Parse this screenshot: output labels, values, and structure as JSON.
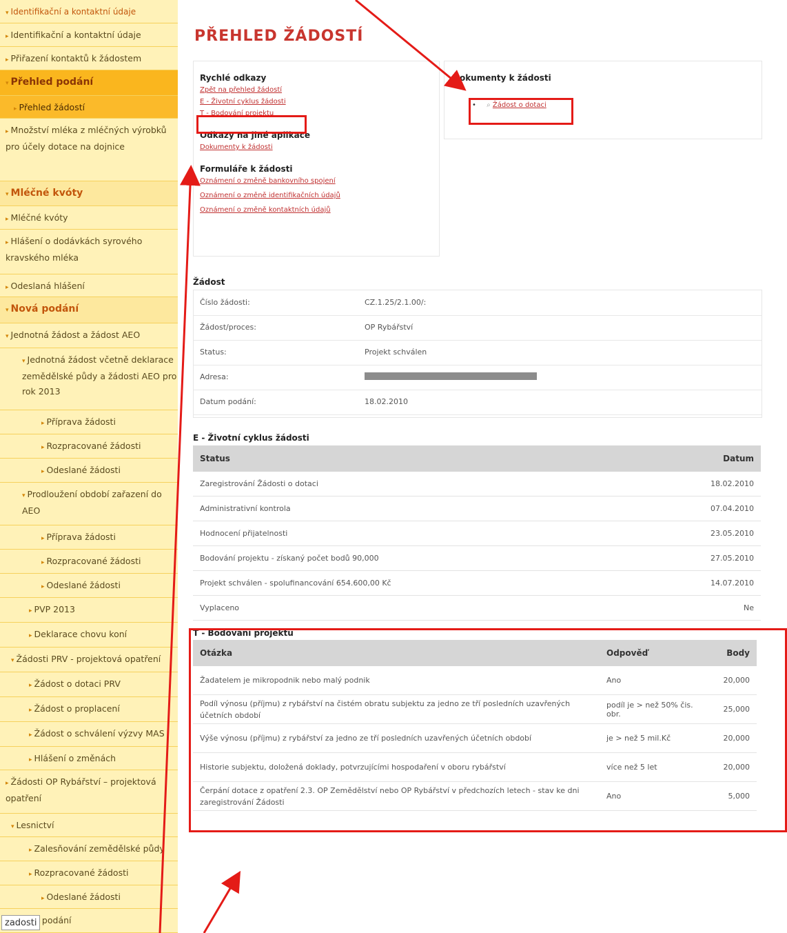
{
  "sidebar": {
    "items": [
      {
        "label": "Identifikační a kontaktní údaje",
        "type": "top"
      },
      {
        "label": "Identifikační a kontaktní údaje",
        "type": "item"
      },
      {
        "label": "Přiřazení kontaktů k žádostem",
        "type": "item"
      },
      {
        "label": "Přehled podání",
        "type": "header_active"
      },
      {
        "label": "Přehled žádostí",
        "type": "active"
      },
      {
        "label": "Množství mléka z mléčných výrobků pro účely dotace na dojnice",
        "type": "item"
      },
      {
        "label": "Mléčné kvóty",
        "type": "header"
      },
      {
        "label": "Mléčné kvóty",
        "type": "item"
      },
      {
        "label": "Hlášení o dodávkách syrového kravského mléka",
        "type": "item"
      },
      {
        "label": "Odeslaná hlášení",
        "type": "item"
      },
      {
        "label": "Nová podání",
        "type": "header"
      },
      {
        "label": "Jednotná žádost a žádost AEO",
        "type": "item"
      },
      {
        "label": "Jednotná žádost včetně deklarace zemědělské půdy a žádosti AEO pro rok 2013",
        "type": "item"
      },
      {
        "label": "Příprava žádosti",
        "type": "item"
      },
      {
        "label": "Rozpracované žádosti",
        "type": "item"
      },
      {
        "label": "Odeslané žádosti",
        "type": "item"
      },
      {
        "label": "Prodloužení období zařazení do AEO",
        "type": "item"
      },
      {
        "label": "Příprava žádosti",
        "type": "item"
      },
      {
        "label": "Rozpracované žádosti",
        "type": "item"
      },
      {
        "label": "Odeslané žádosti",
        "type": "item"
      },
      {
        "label": "PVP 2013",
        "type": "item"
      },
      {
        "label": "Deklarace chovu koní",
        "type": "item"
      },
      {
        "label": "Žádosti PRV - projektová opatření",
        "type": "item"
      },
      {
        "label": "Žádost o dotaci PRV",
        "type": "item"
      },
      {
        "label": "Žádost o proplacení",
        "type": "item"
      },
      {
        "label": "Žádost o schválení výzvy MAS",
        "type": "item"
      },
      {
        "label": "Hlášení o změnách",
        "type": "item"
      },
      {
        "label": "Žádosti OP Rybářství – projektová opatření",
        "type": "item"
      },
      {
        "label": "Lesnictví",
        "type": "item"
      },
      {
        "label": "Zalesňování zemědělské půdy",
        "type": "item"
      },
      {
        "label": "Rozpracované žádosti",
        "type": "item"
      },
      {
        "label": "Odeslané žádosti",
        "type": "item"
      },
      {
        "label": "...ková podání",
        "type": "item"
      }
    ],
    "tooltip": "zadosti"
  },
  "page_title": "PŘEHLED ŽÁDOSTÍ",
  "quick_links": {
    "title": "Rychlé odkazy",
    "links": [
      "Zpět na přehled žádostí",
      "E - Životní cyklus žádosti",
      "T - Bodování projektu"
    ],
    "other_title": "Odkazy na jiné aplikace",
    "other_links": [
      "Dokumenty k žádosti"
    ],
    "forms_title": "Formuláře k žádosti",
    "forms_links": [
      "Oznámení o změně bankovního spojení",
      "Oznámení o změně identifikačních údajů",
      "Oznámení o změně kontaktních údajů"
    ]
  },
  "documents": {
    "title": "Dokumenty k žádosti",
    "items": [
      "Žádost o dotaci"
    ]
  },
  "zadost": {
    "title": "Žádost",
    "rows": [
      {
        "label": "Číslo žádosti:",
        "value": "CZ.1.25/2.1.00/:"
      },
      {
        "label": "Žádost/proces:",
        "value": "OP Rybářství"
      },
      {
        "label": "Status:",
        "value": "Projekt schválen"
      },
      {
        "label": "Adresa:",
        "value": ""
      },
      {
        "label": "Datum podání:",
        "value": "18.02.2010"
      }
    ]
  },
  "lifecycle": {
    "title": "E - Životní cyklus žádosti",
    "headers": [
      "Status",
      "Datum"
    ],
    "rows": [
      [
        "Zaregistrování Žádosti o dotaci",
        "18.02.2010"
      ],
      [
        "Administrativní kontrola",
        "07.04.2010"
      ],
      [
        "Hodnocení přijatelnosti",
        "23.05.2010"
      ],
      [
        "Bodování projektu - získaný počet bodů 90,000",
        "27.05.2010"
      ],
      [
        "Projekt schválen - spolufinancování 654.600,00 Kč",
        "14.07.2010"
      ],
      [
        "Vyplaceno",
        "Ne"
      ]
    ]
  },
  "scoring": {
    "title": "T - Bodování projektu",
    "headers": [
      "Otázka",
      "Odpověď",
      "Body"
    ],
    "rows": [
      [
        "Žadatelem je mikropodnik nebo malý podnik",
        "Ano",
        "20,000"
      ],
      [
        "Podíl výnosu (příjmu) z rybářství na čistém obratu subjektu za jedno ze tří posledních uzavřených účetních období",
        "podíl je > než 50% čis. obr.",
        "25,000"
      ],
      [
        "Výše výnosu (příjmu) z rybářství za jedno ze tří posledních uzavřených účetních období",
        "je > než 5 mil.Kč",
        "20,000"
      ],
      [
        "Historie subjektu, doložená doklady, potvrzujícími hospodaření v oboru rybářství",
        "více než 5 let",
        "20,000"
      ],
      [
        "Čerpání dotace z opatření 2.3. OP Zemědělství nebo OP Rybářství v předchozích letech - stav ke dni zaregistrování Žádosti",
        "Ano",
        "5,000"
      ]
    ]
  },
  "colors": {
    "highlight": "#e41b17",
    "title": "#c8352e",
    "sidebar_bg": "#fff2b8",
    "sidebar_active": "#fbba2a"
  }
}
